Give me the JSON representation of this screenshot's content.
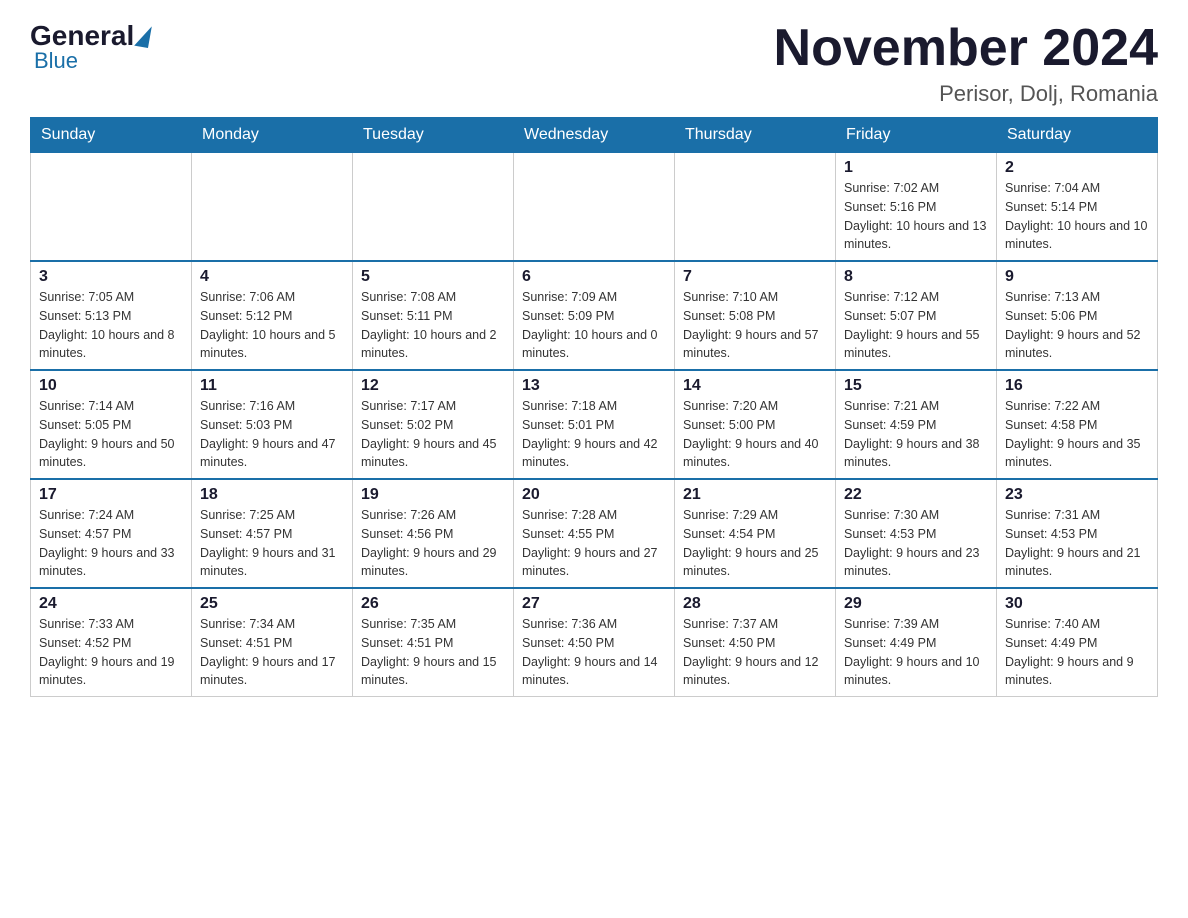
{
  "header": {
    "logo_general": "General",
    "logo_blue": "Blue",
    "title": "November 2024",
    "subtitle": "Perisor, Dolj, Romania"
  },
  "days_of_week": [
    "Sunday",
    "Monday",
    "Tuesday",
    "Wednesday",
    "Thursday",
    "Friday",
    "Saturday"
  ],
  "weeks": [
    [
      {
        "day": "",
        "info": ""
      },
      {
        "day": "",
        "info": ""
      },
      {
        "day": "",
        "info": ""
      },
      {
        "day": "",
        "info": ""
      },
      {
        "day": "",
        "info": ""
      },
      {
        "day": "1",
        "info": "Sunrise: 7:02 AM\nSunset: 5:16 PM\nDaylight: 10 hours and 13 minutes."
      },
      {
        "day": "2",
        "info": "Sunrise: 7:04 AM\nSunset: 5:14 PM\nDaylight: 10 hours and 10 minutes."
      }
    ],
    [
      {
        "day": "3",
        "info": "Sunrise: 7:05 AM\nSunset: 5:13 PM\nDaylight: 10 hours and 8 minutes."
      },
      {
        "day": "4",
        "info": "Sunrise: 7:06 AM\nSunset: 5:12 PM\nDaylight: 10 hours and 5 minutes."
      },
      {
        "day": "5",
        "info": "Sunrise: 7:08 AM\nSunset: 5:11 PM\nDaylight: 10 hours and 2 minutes."
      },
      {
        "day": "6",
        "info": "Sunrise: 7:09 AM\nSunset: 5:09 PM\nDaylight: 10 hours and 0 minutes."
      },
      {
        "day": "7",
        "info": "Sunrise: 7:10 AM\nSunset: 5:08 PM\nDaylight: 9 hours and 57 minutes."
      },
      {
        "day": "8",
        "info": "Sunrise: 7:12 AM\nSunset: 5:07 PM\nDaylight: 9 hours and 55 minutes."
      },
      {
        "day": "9",
        "info": "Sunrise: 7:13 AM\nSunset: 5:06 PM\nDaylight: 9 hours and 52 minutes."
      }
    ],
    [
      {
        "day": "10",
        "info": "Sunrise: 7:14 AM\nSunset: 5:05 PM\nDaylight: 9 hours and 50 minutes."
      },
      {
        "day": "11",
        "info": "Sunrise: 7:16 AM\nSunset: 5:03 PM\nDaylight: 9 hours and 47 minutes."
      },
      {
        "day": "12",
        "info": "Sunrise: 7:17 AM\nSunset: 5:02 PM\nDaylight: 9 hours and 45 minutes."
      },
      {
        "day": "13",
        "info": "Sunrise: 7:18 AM\nSunset: 5:01 PM\nDaylight: 9 hours and 42 minutes."
      },
      {
        "day": "14",
        "info": "Sunrise: 7:20 AM\nSunset: 5:00 PM\nDaylight: 9 hours and 40 minutes."
      },
      {
        "day": "15",
        "info": "Sunrise: 7:21 AM\nSunset: 4:59 PM\nDaylight: 9 hours and 38 minutes."
      },
      {
        "day": "16",
        "info": "Sunrise: 7:22 AM\nSunset: 4:58 PM\nDaylight: 9 hours and 35 minutes."
      }
    ],
    [
      {
        "day": "17",
        "info": "Sunrise: 7:24 AM\nSunset: 4:57 PM\nDaylight: 9 hours and 33 minutes."
      },
      {
        "day": "18",
        "info": "Sunrise: 7:25 AM\nSunset: 4:57 PM\nDaylight: 9 hours and 31 minutes."
      },
      {
        "day": "19",
        "info": "Sunrise: 7:26 AM\nSunset: 4:56 PM\nDaylight: 9 hours and 29 minutes."
      },
      {
        "day": "20",
        "info": "Sunrise: 7:28 AM\nSunset: 4:55 PM\nDaylight: 9 hours and 27 minutes."
      },
      {
        "day": "21",
        "info": "Sunrise: 7:29 AM\nSunset: 4:54 PM\nDaylight: 9 hours and 25 minutes."
      },
      {
        "day": "22",
        "info": "Sunrise: 7:30 AM\nSunset: 4:53 PM\nDaylight: 9 hours and 23 minutes."
      },
      {
        "day": "23",
        "info": "Sunrise: 7:31 AM\nSunset: 4:53 PM\nDaylight: 9 hours and 21 minutes."
      }
    ],
    [
      {
        "day": "24",
        "info": "Sunrise: 7:33 AM\nSunset: 4:52 PM\nDaylight: 9 hours and 19 minutes."
      },
      {
        "day": "25",
        "info": "Sunrise: 7:34 AM\nSunset: 4:51 PM\nDaylight: 9 hours and 17 minutes."
      },
      {
        "day": "26",
        "info": "Sunrise: 7:35 AM\nSunset: 4:51 PM\nDaylight: 9 hours and 15 minutes."
      },
      {
        "day": "27",
        "info": "Sunrise: 7:36 AM\nSunset: 4:50 PM\nDaylight: 9 hours and 14 minutes."
      },
      {
        "day": "28",
        "info": "Sunrise: 7:37 AM\nSunset: 4:50 PM\nDaylight: 9 hours and 12 minutes."
      },
      {
        "day": "29",
        "info": "Sunrise: 7:39 AM\nSunset: 4:49 PM\nDaylight: 9 hours and 10 minutes."
      },
      {
        "day": "30",
        "info": "Sunrise: 7:40 AM\nSunset: 4:49 PM\nDaylight: 9 hours and 9 minutes."
      }
    ]
  ]
}
